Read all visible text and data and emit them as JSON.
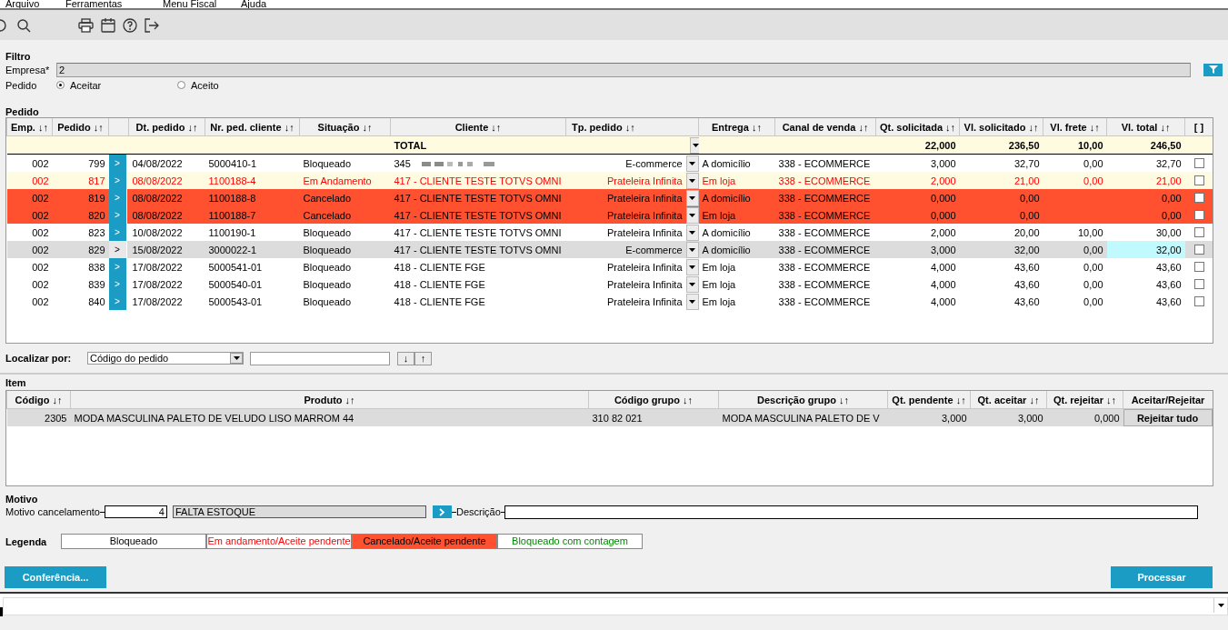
{
  "menu": [
    "Arquivo",
    "Ferramentas",
    "Menu Fiscal",
    "Ajuda"
  ],
  "filter": {
    "title": "Filtro",
    "company_label": "Empresa*",
    "company_value": "2",
    "order_label": "Pedido",
    "options": [
      {
        "label": "Aceitar",
        "selected": true
      },
      {
        "label": "Aceito",
        "selected": false
      }
    ]
  },
  "orders": {
    "title": "Pedido",
    "columns": [
      "Emp. ↓↑",
      "Pedido ↓↑",
      "Dt. pedido ↓↑",
      "Nr. ped. cliente ↓↑",
      "Situação ↓↑",
      "Cliente ↓↑",
      "Tp. pedido ↓↑",
      "Entrega ↓↑",
      "Canal de venda ↓↑",
      "Qt. solicitada ↓↑",
      "Vl. solicitado ↓↑",
      "Vl. frete ↓↑",
      "Vl. total ↓↑",
      "[ ]"
    ],
    "total": {
      "label": "TOTAL",
      "qt": "22,000",
      "vl": "236,50",
      "frete": "10,00",
      "total": "246,50"
    },
    "rows": [
      {
        "emp": "002",
        "pedido": "799",
        "action": ">",
        "dt": "04/08/2022",
        "nr": "5000410-1",
        "situacao": "Bloqueado",
        "cliente": "345",
        "redacted": true,
        "tp": "E-commerce",
        "entrega": "A domicílio",
        "canal": "338 - ECOMMERCE",
        "qt": "3,000",
        "vl": "32,70",
        "frete": "0,00",
        "total": "32,70",
        "kind": "blocked",
        "selected": false,
        "checked": false
      },
      {
        "emp": "002",
        "pedido": "817",
        "action": ">",
        "dt": "08/08/2022",
        "nr": "1100188-4",
        "situacao": "Em Andamento",
        "cliente": "417 - CLIENTE TESTE TOTVS OMNI",
        "tp": "Prateleira Infinita",
        "entrega": "Em loja",
        "canal": "338 - ECOMMERCE",
        "qt": "2,000",
        "vl": "21,00",
        "frete": "0,00",
        "total": "21,00",
        "kind": "in_progress",
        "selected": false,
        "checked": false
      },
      {
        "emp": "002",
        "pedido": "819",
        "action": ">",
        "dt": "08/08/2022",
        "nr": "1100188-8",
        "situacao": "Cancelado",
        "cliente": "417 - CLIENTE TESTE TOTVS OMNI",
        "tp": "Prateleira Infinita",
        "entrega": "A domicílio",
        "canal": "338 - ECOMMERCE",
        "qt": "0,000",
        "vl": "0,00",
        "total": "0,00",
        "kind": "cancelled",
        "selected": false,
        "checked": false
      },
      {
        "emp": "002",
        "pedido": "820",
        "action": ">",
        "dt": "08/08/2022",
        "nr": "1100188-7",
        "situacao": "Cancelado",
        "cliente": "417 - CLIENTE TESTE TOTVS OMNI",
        "tp": "Prateleira Infinita",
        "entrega": "Em loja",
        "canal": "338 - ECOMMERCE",
        "qt": "0,000",
        "vl": "0,00",
        "total": "0,00",
        "kind": "cancelled",
        "selected": false,
        "checked": false
      },
      {
        "emp": "002",
        "pedido": "823",
        "action": ">",
        "dt": "10/08/2022",
        "nr": "1100190-1",
        "situacao": "Bloqueado",
        "cliente": "417 - CLIENTE TESTE TOTVS OMNI",
        "tp": "Prateleira Infinita",
        "entrega": "A domicílio",
        "canal": "338 - ECOMMERCE",
        "qt": "2,000",
        "vl": "20,00",
        "frete": "10,00",
        "total": "30,00",
        "kind": "blocked",
        "selected": false,
        "checked": false
      },
      {
        "emp": "002",
        "pedido": "829",
        "action": ">",
        "dt": "15/08/2022",
        "nr": "3000022-1",
        "situacao": "Bloqueado",
        "cliente": "417 - CLIENTE TESTE TOTVS OMNI",
        "tp": "E-commerce",
        "entrega": "A domicílio",
        "canal": "338 - ECOMMERCE",
        "qt": "3,000",
        "vl": "32,00",
        "frete": "0,00",
        "total": "32,00",
        "kind": "blocked",
        "selected": true,
        "checked": false
      },
      {
        "emp": "002",
        "pedido": "838",
        "action": ">",
        "dt": "17/08/2022",
        "nr": "5000541-01",
        "situacao": "Bloqueado",
        "cliente": "418 - CLIENTE FGE",
        "tp": "Prateleira Infinita",
        "entrega": "Em loja",
        "canal": "338 - ECOMMERCE",
        "qt": "4,000",
        "vl": "43,60",
        "frete": "0,00",
        "total": "43,60",
        "kind": "blocked",
        "selected": false,
        "checked": false
      },
      {
        "emp": "002",
        "pedido": "839",
        "action": ">",
        "dt": "17/08/2022",
        "nr": "5000540-01",
        "situacao": "Bloqueado",
        "cliente": "418 - CLIENTE FGE",
        "tp": "Prateleira Infinita",
        "entrega": "Em loja",
        "canal": "338 - ECOMMERCE",
        "qt": "4,000",
        "vl": "43,60",
        "frete": "0,00",
        "total": "43,60",
        "kind": "blocked",
        "selected": false,
        "checked": false
      },
      {
        "emp": "002",
        "pedido": "840",
        "action": ">",
        "dt": "17/08/2022",
        "nr": "5000543-01",
        "situacao": "Bloqueado",
        "cliente": "418 - CLIENTE FGE",
        "tp": "Prateleira Infinita",
        "entrega": "Em loja",
        "canal": "338 - ECOMMERCE",
        "qt": "4,000",
        "vl": "43,60",
        "frete": "0,00",
        "total": "43,60",
        "kind": "blocked",
        "selected": false,
        "checked": false
      }
    ]
  },
  "locate": {
    "label": "Localizar por:",
    "select": "Código do pedido",
    "down": "↓",
    "up": "↑"
  },
  "items": {
    "title": "Item",
    "columns": [
      "Código ↓↑",
      "Produto ↓↑",
      "Código grupo ↓↑",
      "Descrição grupo ↓↑",
      "Qt. pendente ↓↑",
      "Qt. aceitar ↓↑",
      "Qt. rejeitar ↓↑",
      "Aceitar/Rejeitar"
    ],
    "rows": [
      {
        "codigo": "2305",
        "produto": "MODA MASCULINA PALETO DE VELUDO LISO MARROM 44",
        "grupo": "310 82 021",
        "descricao": "MODA MASCULINA PALETO DE V",
        "pendente": "3,000",
        "aceitar": "3,000",
        "rejeitar": "0,000",
        "action": "Rejeitar tudo",
        "selected": true
      }
    ]
  },
  "reason": {
    "title": "Motivo",
    "label": "Motivo cancelamento",
    "code": "4",
    "text": "FALTA ESTOQUE",
    "description_label": "Descrição"
  },
  "legend": {
    "title": "Legenda",
    "items": [
      {
        "label": "Bloqueado",
        "kind": "blocked"
      },
      {
        "label": "Em andamento/Aceite pendente",
        "kind": "in_progress"
      },
      {
        "label": "Cancelado/Aceite pendente",
        "kind": "cancelled"
      },
      {
        "label": "Bloqueado com contagem",
        "kind": "counted"
      }
    ]
  },
  "buttons": {
    "left": "Conferência...",
    "right": "Processar"
  }
}
